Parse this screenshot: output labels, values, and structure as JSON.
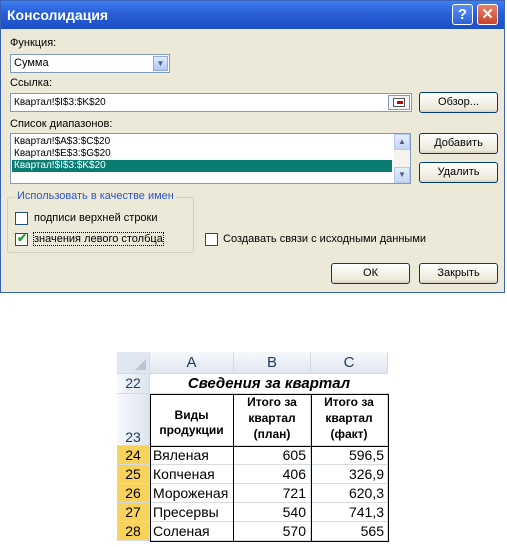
{
  "dialog": {
    "title": "Консолидация",
    "help_glyph": "?",
    "close_glyph": "✕",
    "function_label": "Функция:",
    "function_value": "Сумма",
    "reference_label": "Ссылка:",
    "reference_value": "Квартал!$I$3:$K$20",
    "browse_label": "Обзор...",
    "ranges_label": "Список диапазонов:",
    "ranges": [
      "Квартал!$A$3:$C$20",
      "Квартал!$E$3:$G$20",
      "Квартал!$I$3:$K$20"
    ],
    "selected_range_index": 2,
    "add_label": "Добавить",
    "delete_label": "Удалить",
    "group_title": "Использовать в качестве имен",
    "top_row_label": "подписи верхней строки",
    "top_row_checked": false,
    "left_col_label": "значения левого столбца",
    "left_col_checked": true,
    "link_label": "Создавать связи с исходными данными",
    "link_checked": false,
    "ok_label": "ОК",
    "close_label": "Закрыть"
  },
  "sheet": {
    "columns": [
      "A",
      "B",
      "C"
    ],
    "title_row": "22",
    "title": "Сведения за квартал",
    "header_row": "23",
    "headers": [
      "Виды продукции",
      "Итого за квартал (план)",
      "Итого за квартал (факт)"
    ],
    "rows": [
      {
        "num": "24",
        "name": "Вяленая",
        "plan": "605",
        "fact": "596,5"
      },
      {
        "num": "25",
        "name": "Копченая",
        "plan": "406",
        "fact": "326,9"
      },
      {
        "num": "26",
        "name": "Мороженая",
        "plan": "721",
        "fact": "620,3"
      },
      {
        "num": "27",
        "name": "Пресервы",
        "plan": "540",
        "fact": "741,3"
      },
      {
        "num": "28",
        "name": "Соленая",
        "plan": "570",
        "fact": "565"
      }
    ],
    "colors": {
      "active_row_header": "#f8d35c",
      "selection": "#0a7d73"
    }
  }
}
